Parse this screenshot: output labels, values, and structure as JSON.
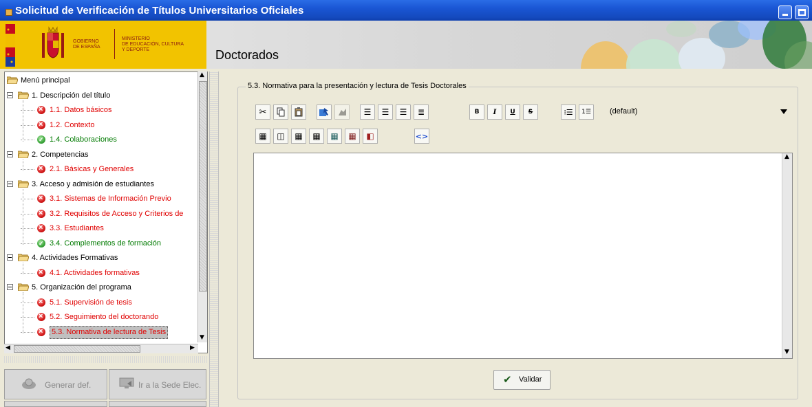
{
  "window": {
    "title": "Solicitud de Verificación de Títulos Universitarios Oficiales",
    "buttons": [
      "minimize-icon",
      "maximize-icon"
    ]
  },
  "banner": {
    "gov_line1": "GOBIERNO",
    "gov_line2": "DE ESPAÑA",
    "ministry_line1": "MINISTERIO",
    "ministry_line2": "DE EDUCACIÓN, CULTURA",
    "ministry_line3": "Y DEPORTE",
    "heading": "Doctorados",
    "brand_color": "#f2c300"
  },
  "tree": {
    "root": "Menú principal",
    "sections": [
      {
        "label": "1. Descripción del título",
        "children": [
          {
            "label": "1.1. Datos básicos",
            "status": "error"
          },
          {
            "label": "1.2. Contexto",
            "status": "error"
          },
          {
            "label": "1.4. Colaboraciones",
            "status": "ok"
          }
        ]
      },
      {
        "label": "2. Competencias",
        "children": [
          {
            "label": "2.1. Básicas y Generales",
            "status": "error"
          }
        ]
      },
      {
        "label": "3. Acceso y admisión de estudiantes",
        "children": [
          {
            "label": "3.1. Sistemas de Información Previo",
            "status": "error"
          },
          {
            "label": "3.2. Requisitos de Acceso y Criterios de",
            "status": "error"
          },
          {
            "label": "3.3. Estudiantes",
            "status": "error"
          },
          {
            "label": "3.4. Complementos de formación",
            "status": "ok"
          }
        ]
      },
      {
        "label": "4. Actividades Formativas",
        "children": [
          {
            "label": "4.1. Actividades formativas",
            "status": "error"
          }
        ]
      },
      {
        "label": "5. Organización del programa",
        "children": [
          {
            "label": "5.1. Supervisión de tesis",
            "status": "error"
          },
          {
            "label": "5.2. Seguimiento del doctorando",
            "status": "error"
          },
          {
            "label": "5.3. Normativa de lectura de Tesis",
            "status": "error",
            "selected": true
          }
        ]
      }
    ]
  },
  "side_buttons": {
    "generate": "Generar def.",
    "sede": "Ir a la Sede Elec."
  },
  "form": {
    "legend": "5.3. Normativa para la presentación y lectura de Tesis Doctorales",
    "style_select": "(default)",
    "toolbar_bold": "B",
    "toolbar_italic": "I",
    "toolbar_underline": "U",
    "toolbar_strike": "S",
    "toolbar_source": "<>",
    "validate": "Validar"
  },
  "colors": {
    "error": "#e00000",
    "ok": "#007a00",
    "titlebar": "#1a56d4"
  }
}
